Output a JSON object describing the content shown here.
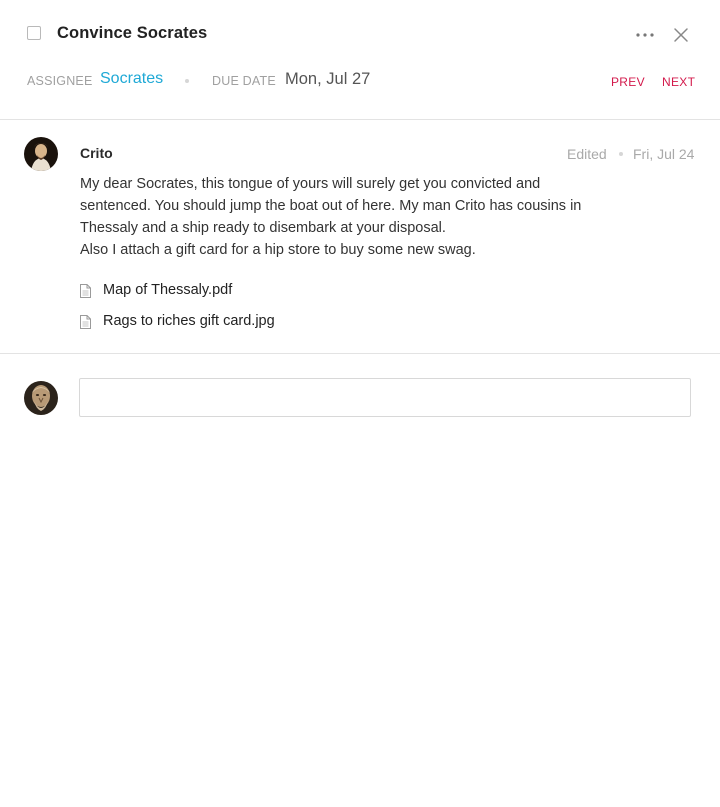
{
  "task": {
    "title": "Convince Socrates",
    "completed": false
  },
  "header_icons": {
    "more": "more-horizontal-icon",
    "close": "close-icon"
  },
  "meta": {
    "assignee_label": "ASSIGNEE",
    "assignee_value": "Socrates",
    "due_date_label": "DUE DATE",
    "due_date_value": "Mon, Jul 27",
    "prev_label": "PREV",
    "next_label": "NEXT"
  },
  "comment": {
    "author": "Crito",
    "edited_label": "Edited",
    "date": "Fri, Jul 24",
    "lines": [
      "My dear Socrates, this tongue of yours will surely get you convicted and",
      "sentenced. You should jump the boat out of here. My man Crito has cousins in",
      "Thessaly and a ship ready to disembark at your disposal.",
      "Also I attach a gift card for a hip store to buy some new swag."
    ],
    "attachments": [
      {
        "name": "Map of Thessaly.pdf",
        "icon": "document-icon"
      },
      {
        "name": "Rags to riches gift card.jpg",
        "icon": "document-icon"
      }
    ]
  },
  "reply": {
    "value": "",
    "placeholder": ""
  },
  "colors": {
    "accent": "#1fa9d6",
    "nav": "#d3194b",
    "muted": "#a0a0a0"
  }
}
